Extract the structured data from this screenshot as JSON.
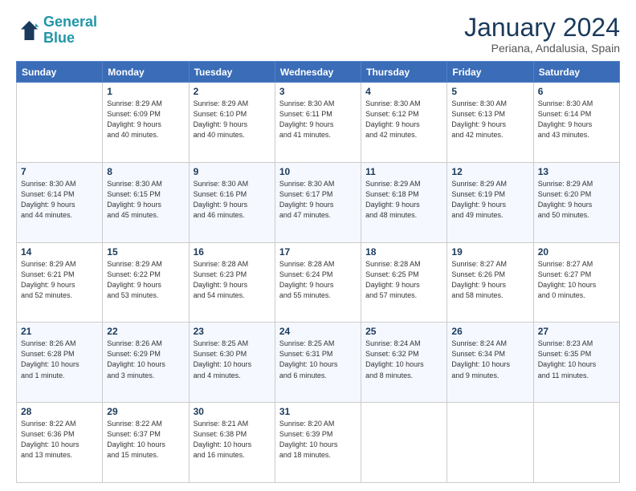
{
  "header": {
    "logo_line1": "General",
    "logo_line2": "Blue",
    "month": "January 2024",
    "location": "Periana, Andalusia, Spain"
  },
  "days_of_week": [
    "Sunday",
    "Monday",
    "Tuesday",
    "Wednesday",
    "Thursday",
    "Friday",
    "Saturday"
  ],
  "weeks": [
    [
      {
        "day": "",
        "info": ""
      },
      {
        "day": "1",
        "info": "Sunrise: 8:29 AM\nSunset: 6:09 PM\nDaylight: 9 hours\nand 40 minutes."
      },
      {
        "day": "2",
        "info": "Sunrise: 8:29 AM\nSunset: 6:10 PM\nDaylight: 9 hours\nand 40 minutes."
      },
      {
        "day": "3",
        "info": "Sunrise: 8:30 AM\nSunset: 6:11 PM\nDaylight: 9 hours\nand 41 minutes."
      },
      {
        "day": "4",
        "info": "Sunrise: 8:30 AM\nSunset: 6:12 PM\nDaylight: 9 hours\nand 42 minutes."
      },
      {
        "day": "5",
        "info": "Sunrise: 8:30 AM\nSunset: 6:13 PM\nDaylight: 9 hours\nand 42 minutes."
      },
      {
        "day": "6",
        "info": "Sunrise: 8:30 AM\nSunset: 6:14 PM\nDaylight: 9 hours\nand 43 minutes."
      }
    ],
    [
      {
        "day": "7",
        "info": "Sunrise: 8:30 AM\nSunset: 6:14 PM\nDaylight: 9 hours\nand 44 minutes."
      },
      {
        "day": "8",
        "info": "Sunrise: 8:30 AM\nSunset: 6:15 PM\nDaylight: 9 hours\nand 45 minutes."
      },
      {
        "day": "9",
        "info": "Sunrise: 8:30 AM\nSunset: 6:16 PM\nDaylight: 9 hours\nand 46 minutes."
      },
      {
        "day": "10",
        "info": "Sunrise: 8:30 AM\nSunset: 6:17 PM\nDaylight: 9 hours\nand 47 minutes."
      },
      {
        "day": "11",
        "info": "Sunrise: 8:29 AM\nSunset: 6:18 PM\nDaylight: 9 hours\nand 48 minutes."
      },
      {
        "day": "12",
        "info": "Sunrise: 8:29 AM\nSunset: 6:19 PM\nDaylight: 9 hours\nand 49 minutes."
      },
      {
        "day": "13",
        "info": "Sunrise: 8:29 AM\nSunset: 6:20 PM\nDaylight: 9 hours\nand 50 minutes."
      }
    ],
    [
      {
        "day": "14",
        "info": "Sunrise: 8:29 AM\nSunset: 6:21 PM\nDaylight: 9 hours\nand 52 minutes."
      },
      {
        "day": "15",
        "info": "Sunrise: 8:29 AM\nSunset: 6:22 PM\nDaylight: 9 hours\nand 53 minutes."
      },
      {
        "day": "16",
        "info": "Sunrise: 8:28 AM\nSunset: 6:23 PM\nDaylight: 9 hours\nand 54 minutes."
      },
      {
        "day": "17",
        "info": "Sunrise: 8:28 AM\nSunset: 6:24 PM\nDaylight: 9 hours\nand 55 minutes."
      },
      {
        "day": "18",
        "info": "Sunrise: 8:28 AM\nSunset: 6:25 PM\nDaylight: 9 hours\nand 57 minutes."
      },
      {
        "day": "19",
        "info": "Sunrise: 8:27 AM\nSunset: 6:26 PM\nDaylight: 9 hours\nand 58 minutes."
      },
      {
        "day": "20",
        "info": "Sunrise: 8:27 AM\nSunset: 6:27 PM\nDaylight: 10 hours\nand 0 minutes."
      }
    ],
    [
      {
        "day": "21",
        "info": "Sunrise: 8:26 AM\nSunset: 6:28 PM\nDaylight: 10 hours\nand 1 minute."
      },
      {
        "day": "22",
        "info": "Sunrise: 8:26 AM\nSunset: 6:29 PM\nDaylight: 10 hours\nand 3 minutes."
      },
      {
        "day": "23",
        "info": "Sunrise: 8:25 AM\nSunset: 6:30 PM\nDaylight: 10 hours\nand 4 minutes."
      },
      {
        "day": "24",
        "info": "Sunrise: 8:25 AM\nSunset: 6:31 PM\nDaylight: 10 hours\nand 6 minutes."
      },
      {
        "day": "25",
        "info": "Sunrise: 8:24 AM\nSunset: 6:32 PM\nDaylight: 10 hours\nand 8 minutes."
      },
      {
        "day": "26",
        "info": "Sunrise: 8:24 AM\nSunset: 6:34 PM\nDaylight: 10 hours\nand 9 minutes."
      },
      {
        "day": "27",
        "info": "Sunrise: 8:23 AM\nSunset: 6:35 PM\nDaylight: 10 hours\nand 11 minutes."
      }
    ],
    [
      {
        "day": "28",
        "info": "Sunrise: 8:22 AM\nSunset: 6:36 PM\nDaylight: 10 hours\nand 13 minutes."
      },
      {
        "day": "29",
        "info": "Sunrise: 8:22 AM\nSunset: 6:37 PM\nDaylight: 10 hours\nand 15 minutes."
      },
      {
        "day": "30",
        "info": "Sunrise: 8:21 AM\nSunset: 6:38 PM\nDaylight: 10 hours\nand 16 minutes."
      },
      {
        "day": "31",
        "info": "Sunrise: 8:20 AM\nSunset: 6:39 PM\nDaylight: 10 hours\nand 18 minutes."
      },
      {
        "day": "",
        "info": ""
      },
      {
        "day": "",
        "info": ""
      },
      {
        "day": "",
        "info": ""
      }
    ]
  ]
}
